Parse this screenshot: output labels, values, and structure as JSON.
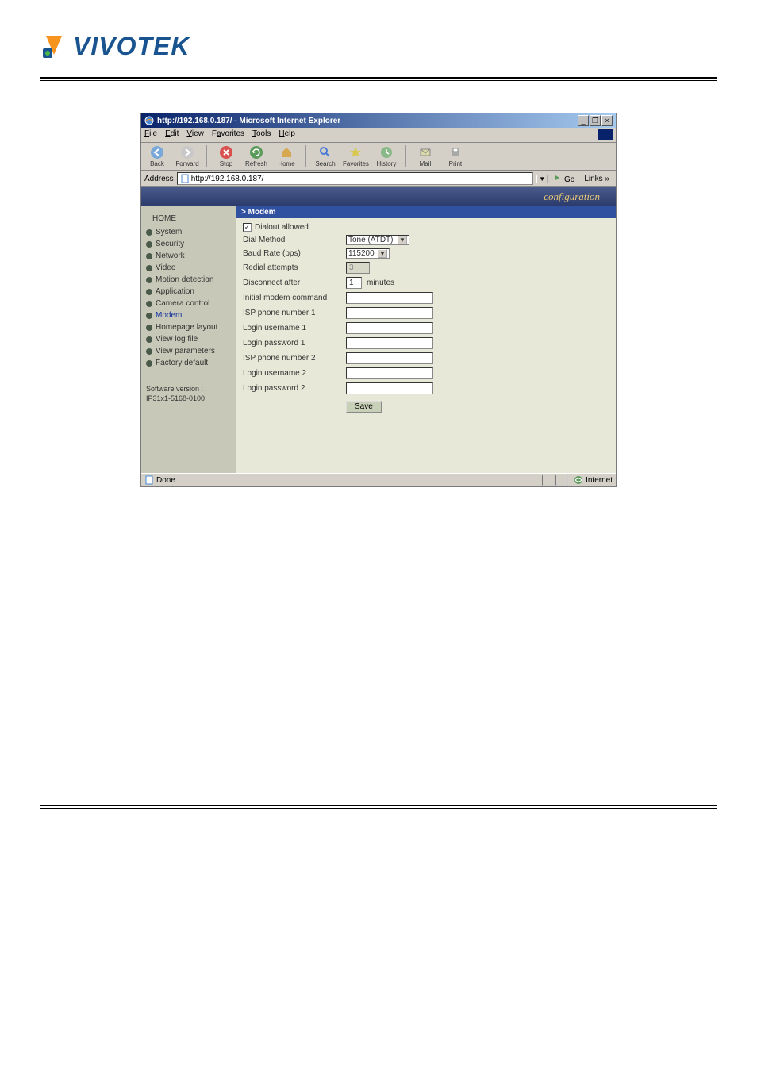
{
  "logo": {
    "text": "VIVOTEK"
  },
  "ie_window": {
    "title": "http://192.168.0.187/ - Microsoft Internet Explorer",
    "minimize": "_",
    "maximize": "❐",
    "close": "×",
    "menus": {
      "file": "File",
      "edit": "Edit",
      "view": "View",
      "favorites": "Favorites",
      "tools": "Tools",
      "help": "Help"
    },
    "toolbar": {
      "back": "Back",
      "forward": "Forward",
      "stop": "Stop",
      "refresh": "Refresh",
      "home": "Home",
      "search": "Search",
      "favorites": "Favorites",
      "history": "History",
      "mail": "Mail",
      "print": "Print"
    },
    "address": {
      "label": "Address",
      "value": "http://192.168.0.187/",
      "go": "Go",
      "links": "Links »"
    }
  },
  "banner": "configuration",
  "sidebar": {
    "home": "HOME",
    "items": [
      "System",
      "Security",
      "Network",
      "Video",
      "Motion detection",
      "Application",
      "Camera control",
      "Modem",
      "Homepage layout",
      "View log file",
      "View parameters",
      "Factory default"
    ],
    "current_index": 7,
    "software": {
      "label": "Software version :",
      "value": "IP31x1-5168-0100"
    }
  },
  "panel": {
    "header": "> Modem",
    "fields": {
      "dialout": {
        "label": "Dialout allowed",
        "checked": "✓"
      },
      "dial_method": {
        "label": "Dial Method",
        "value": "Tone (ATDT)"
      },
      "baud": {
        "label": "Baud Rate (bps)",
        "value": "115200"
      },
      "redial": {
        "label": "Redial attempts",
        "value": "3"
      },
      "disconnect": {
        "label": "Disconnect after",
        "value": "1",
        "unit": "minutes"
      },
      "init_cmd": {
        "label": "Initial modem command",
        "value": ""
      },
      "isp1": {
        "label": "ISP phone number 1",
        "value": ""
      },
      "user1": {
        "label": "Login username 1",
        "value": ""
      },
      "pass1": {
        "label": "Login password 1",
        "value": ""
      },
      "isp2": {
        "label": "ISP phone number 2",
        "value": ""
      },
      "user2": {
        "label": "Login username 2",
        "value": ""
      },
      "pass2": {
        "label": "Login password 2",
        "value": ""
      }
    },
    "save": "Save"
  },
  "status": {
    "left": "Done",
    "right": "Internet"
  }
}
